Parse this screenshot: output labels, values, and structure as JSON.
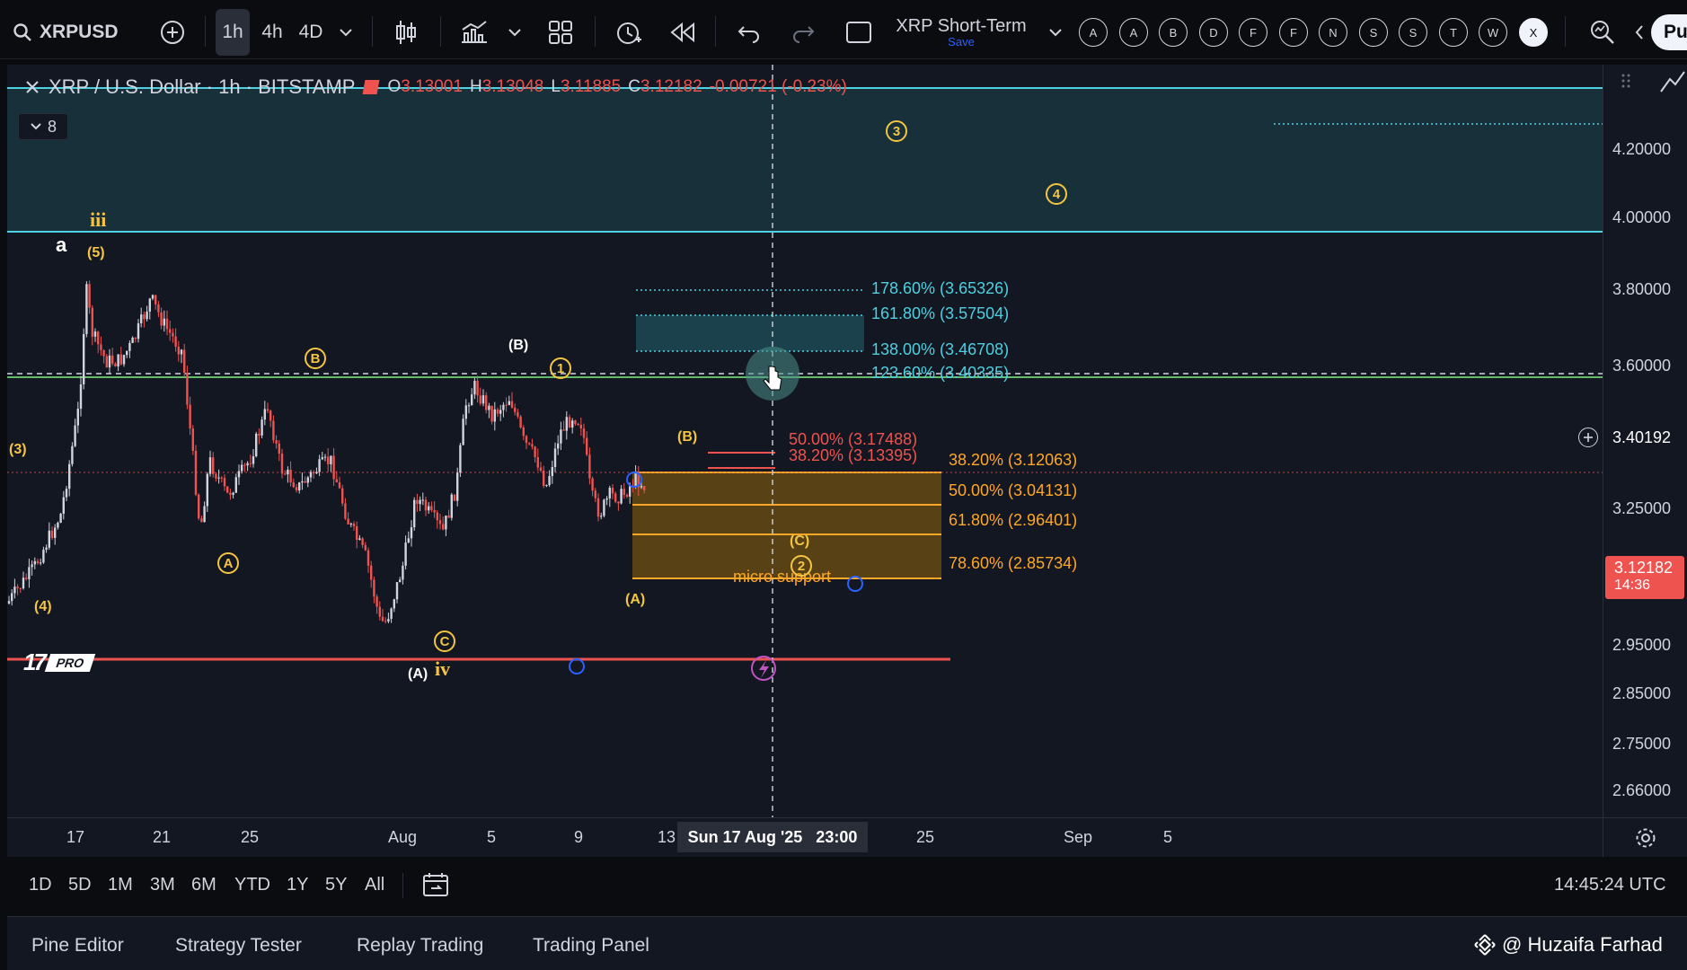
{
  "toolbar": {
    "symbol": "XRPUSD",
    "timeframes": [
      "1h",
      "4h",
      "4D"
    ],
    "layout_name": "XRP Short-Term",
    "layout_status": "Save",
    "quick_buttons": [
      "A",
      "A",
      "B",
      "D",
      "F",
      "F",
      "N",
      "S",
      "S",
      "T",
      "W",
      "X"
    ],
    "publish_label": "Pu"
  },
  "legend": {
    "title": "XRP / U.S. Dollar · 1h · BITSTAMP",
    "open_label": "O",
    "open": "3.13001",
    "high_label": "H",
    "high": "3.13048",
    "low_label": "L",
    "low": "3.11885",
    "close_label": "C",
    "close": "3.12182",
    "change": "-0.00721 (-0.23%)",
    "collapsed_count": "8"
  },
  "price_axis": {
    "labels": [
      "4.20000",
      "4.00000",
      "3.80000",
      "3.60000",
      "3.25000",
      "2.95000",
      "2.85000",
      "2.75000",
      "2.66000"
    ],
    "crosshair_price": "3.40192",
    "last_price": "3.12182",
    "countdown": "14:36"
  },
  "time_axis": {
    "labels": [
      "17",
      "21",
      "25",
      "Aug",
      "5",
      "9",
      "13",
      "25",
      "Sep",
      "5"
    ],
    "crosshair_time": "Sun 17 Aug '25   23:00"
  },
  "fib_extension": [
    {
      "text": "178.60% (3.65326)"
    },
    {
      "text": "161.80% (3.57504)"
    },
    {
      "text": "138.00% (3.46708)"
    },
    {
      "text": "123.60% (3.40335)"
    }
  ],
  "fib_red": [
    {
      "text": "50.00% (3.17488)"
    },
    {
      "text": "38.20% (3.13395)"
    }
  ],
  "fib_retracement": [
    {
      "text": "38.20% (3.12063)"
    },
    {
      "text": "50.00% (3.04131)"
    },
    {
      "text": "61.80% (2.96401)"
    },
    {
      "text": "78.60% (2.85734)"
    }
  ],
  "annotations": {
    "micro_support": "micro support",
    "wave_iii": "iii",
    "wave_iv": "iv",
    "wave_a": "a",
    "w5": "(5)",
    "w3": "(3)",
    "w4": "(4)",
    "wB_paren": "(B)",
    "wB_paren2": "(B)",
    "wA_paren": "(A)",
    "wA_paren2": "(A)",
    "wC_paren": "(C)",
    "c1": "1",
    "c2": "2",
    "c3": "3",
    "c4": "4",
    "cA": "A",
    "cB": "B",
    "cC": "C"
  },
  "branding": {
    "logo_text": "17",
    "pro_badge": "PRO"
  },
  "ranges": [
    "1D",
    "5D",
    "1M",
    "3M",
    "6M",
    "YTD",
    "1Y",
    "5Y",
    "All"
  ],
  "clock": "14:45:24 UTC",
  "panels": [
    "Pine Editor",
    "Strategy Tester",
    "Replay Trading",
    "Trading Panel"
  ],
  "watermark": "@ Huzaifa Farhad",
  "colors": {
    "background": "#131722",
    "bull": "#d1d4dc",
    "bear": "#ef5350",
    "wave_label": "#f5c542",
    "fib_ext": "#4dd0e1",
    "fib_ret": "#ffa726",
    "support_line": "#ef5350",
    "h_line_green": "#66bb6a",
    "zone_cyan": "#4dd0e1"
  }
}
